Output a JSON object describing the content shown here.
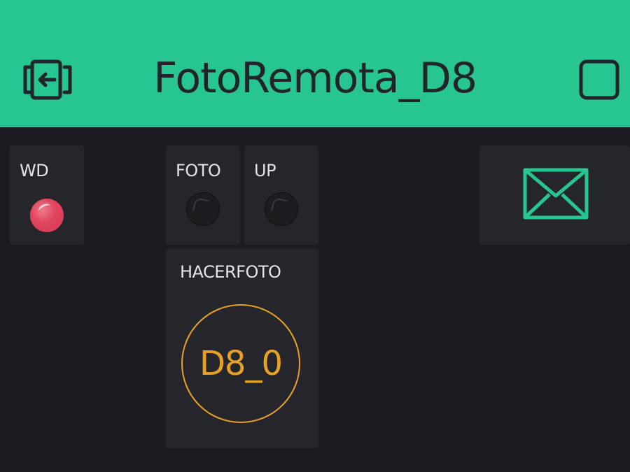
{
  "header": {
    "title": "FotoRemota_D8",
    "background_color": "#26c592",
    "left_icon": "exit-icon",
    "right_icon": "stop-icon"
  },
  "widgets": {
    "wd": {
      "label": "WD",
      "led_state": "on",
      "led_color": "#e2465e"
    },
    "foto": {
      "label": "FOTO",
      "led_state": "off"
    },
    "up": {
      "label": "UP",
      "led_state": "off"
    },
    "hacerfoto": {
      "label": "HACERFOTO",
      "button_label": "D8_0",
      "color": "#e9a124"
    },
    "email": {
      "icon": "envelope-icon",
      "color": "#26c592"
    }
  }
}
